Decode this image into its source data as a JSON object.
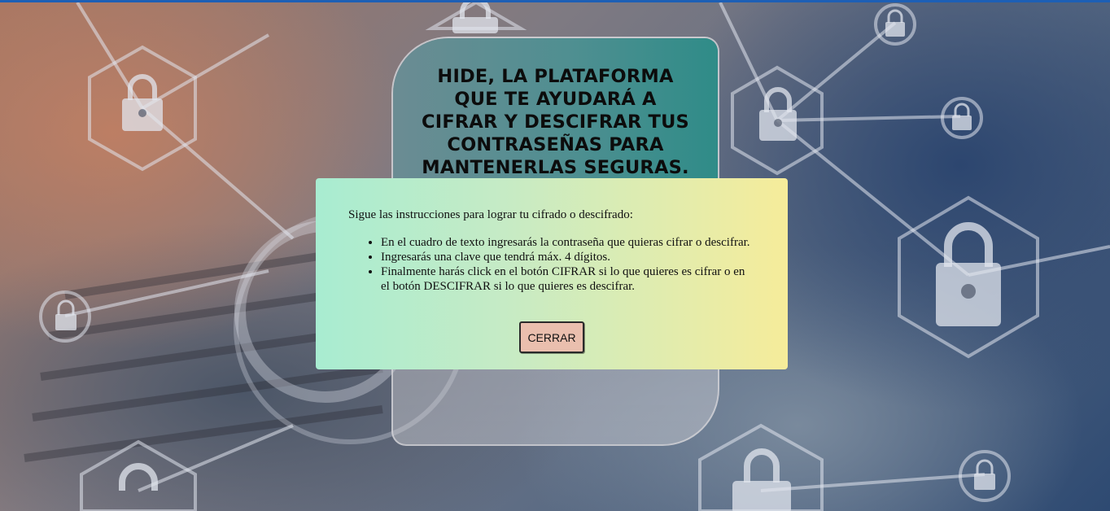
{
  "hero": {
    "title_lines": [
      "HIDE, LA PLATAFORMA",
      "QUE TE AYUDARÁ A",
      "CIFRAR Y DESCIFRAR TUS",
      "CONTRASEÑAS PARA",
      "MANTENERLAS SEGURAS."
    ]
  },
  "modal": {
    "intro": "Sigue las instrucciones para lograr tu cifrado o descifrado:",
    "steps": [
      "En el cuadro de texto ingresarás la contraseña que quieras cifrar o descifrar.",
      "Ingresarás una clave que tendrá máx. 4 dígitos.",
      "Finalmente harás click en el botón CIFRAR si lo que quieres es cifrar o en el botón DESCIFRAR si lo que quieres es descifrar."
    ],
    "close_label": "CERRAR"
  },
  "background": {
    "description_icons": [
      "padlock-icon",
      "keyboard"
    ],
    "colors": {
      "accent_top_bar": "#1d5fb5",
      "hero_teal": "#2f8c88",
      "button_bg": "#eabfae"
    }
  }
}
